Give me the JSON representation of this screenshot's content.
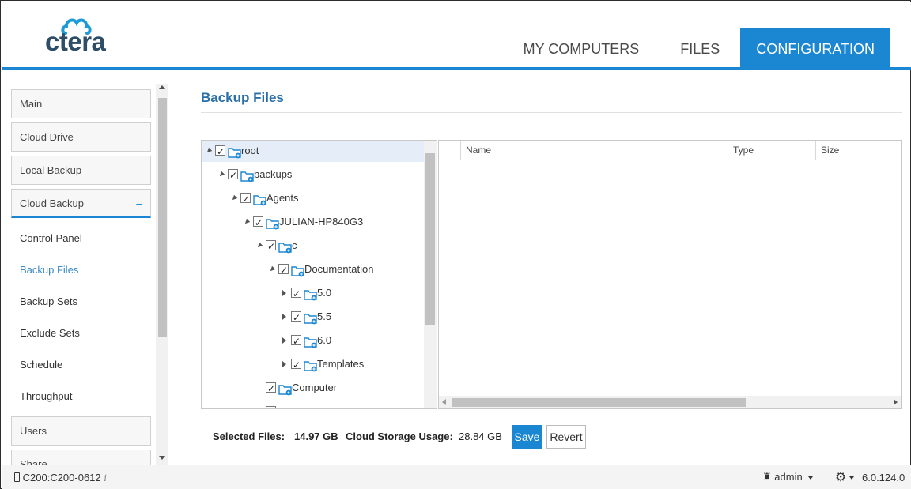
{
  "header": {
    "logo_text": "ctera",
    "tabs": [
      {
        "label": "MY COMPUTERS"
      },
      {
        "label": "FILES"
      },
      {
        "label": "CONFIGURATION",
        "active": true
      }
    ]
  },
  "sidebar": {
    "top_items": [
      {
        "label": "Main"
      },
      {
        "label": "Cloud Drive"
      },
      {
        "label": "Local Backup"
      },
      {
        "label": "Cloud Backup",
        "expand_symbol": "–"
      }
    ],
    "sub_items": [
      {
        "label": "Control Panel"
      },
      {
        "label": "Backup Files",
        "active": true
      },
      {
        "label": "Backup Sets"
      },
      {
        "label": "Exclude Sets"
      },
      {
        "label": "Schedule"
      },
      {
        "label": "Throughput"
      }
    ],
    "bottom_items": [
      {
        "label": "Users"
      },
      {
        "label": "Share"
      }
    ]
  },
  "main": {
    "title": "Backup Files",
    "tree": [
      {
        "label": "root",
        "expanded": true
      },
      {
        "label": "backups",
        "expanded": true
      },
      {
        "label": "Agents",
        "expanded": true
      },
      {
        "label": "JULIAN-HP840G3",
        "expanded": true
      },
      {
        "label": "c",
        "expanded": true
      },
      {
        "label": "Documentation",
        "expanded": true
      },
      {
        "label": "5.0",
        "expanded": false
      },
      {
        "label": "5.5",
        "expanded": false
      },
      {
        "label": "6.0",
        "expanded": false
      },
      {
        "label": "Templates",
        "expanded": false
      },
      {
        "label": "Computer"
      },
      {
        "label": "System State"
      }
    ],
    "file_columns": {
      "name": "Name",
      "type": "Type",
      "size": "Size"
    },
    "summary": {
      "selected_label": "Selected Files:",
      "selected_value": "14.97 GB",
      "usage_label": "Cloud Storage Usage:",
      "usage_value": "28.84 GB"
    },
    "buttons": {
      "save": "Save",
      "revert": "Revert"
    }
  },
  "footer": {
    "device": "C200:C200-0612",
    "info_icon": "i",
    "user": "admin",
    "version": "6.0.124.0"
  },
  "colors": {
    "accent": "#1b87d2",
    "title": "#2a6fa8",
    "logo": "#2e4d67"
  }
}
